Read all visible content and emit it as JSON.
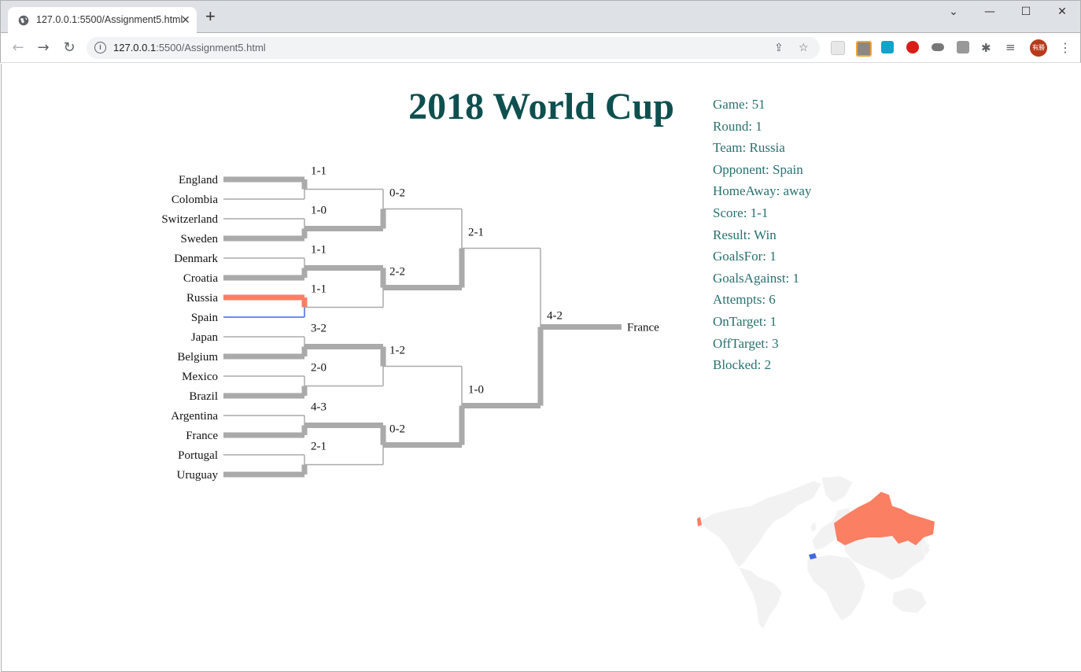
{
  "browser": {
    "tab_title": "127.0.0.1:5500/Assignment5.html",
    "url_host": "127.0.0.1",
    "url_path": ":5500/Assignment5.html",
    "profile_label": "有勝"
  },
  "page": {
    "title": "2018 World Cup"
  },
  "colors": {
    "selected_team": "#fa7f63",
    "opponent": "#4169e1",
    "bracket": "#aaaaaa",
    "text_teal": "#2a7070",
    "title": "#0e4f4f"
  },
  "bracket": {
    "teams": [
      "England",
      "Colombia",
      "Switzerland",
      "Sweden",
      "Denmark",
      "Croatia",
      "Russia",
      "Spain",
      "Japan",
      "Belgium",
      "Mexico",
      "Brazil",
      "Argentina",
      "France",
      "Portugal",
      "Uruguay"
    ],
    "round_of_16_scores": [
      "1-1",
      "1-0",
      "1-1",
      "1-1",
      "3-2",
      "2-0",
      "4-3",
      "2-1"
    ],
    "quarter_final_scores": [
      "0-2",
      "2-2",
      "1-2",
      "0-2"
    ],
    "semi_final_scores": [
      "2-1",
      "1-0"
    ],
    "final_score": "4-2",
    "champion": "France",
    "selected_team": "Russia",
    "selected_opponent": "Spain"
  },
  "match_info": [
    "Game: 51",
    "Round: 1",
    "Team: Russia",
    "Opponent: Spain",
    "HomeAway: away",
    "Score: 1-1",
    "Result: Win",
    "GoalsFor: 1",
    "GoalsAgainst: 1",
    "Attempts: 6",
    "OnTarget: 1",
    "OffTarget: 3",
    "Blocked: 2"
  ],
  "map": {
    "highlighted_team_country": "Russia",
    "highlighted_opponent_country": "Spain"
  }
}
